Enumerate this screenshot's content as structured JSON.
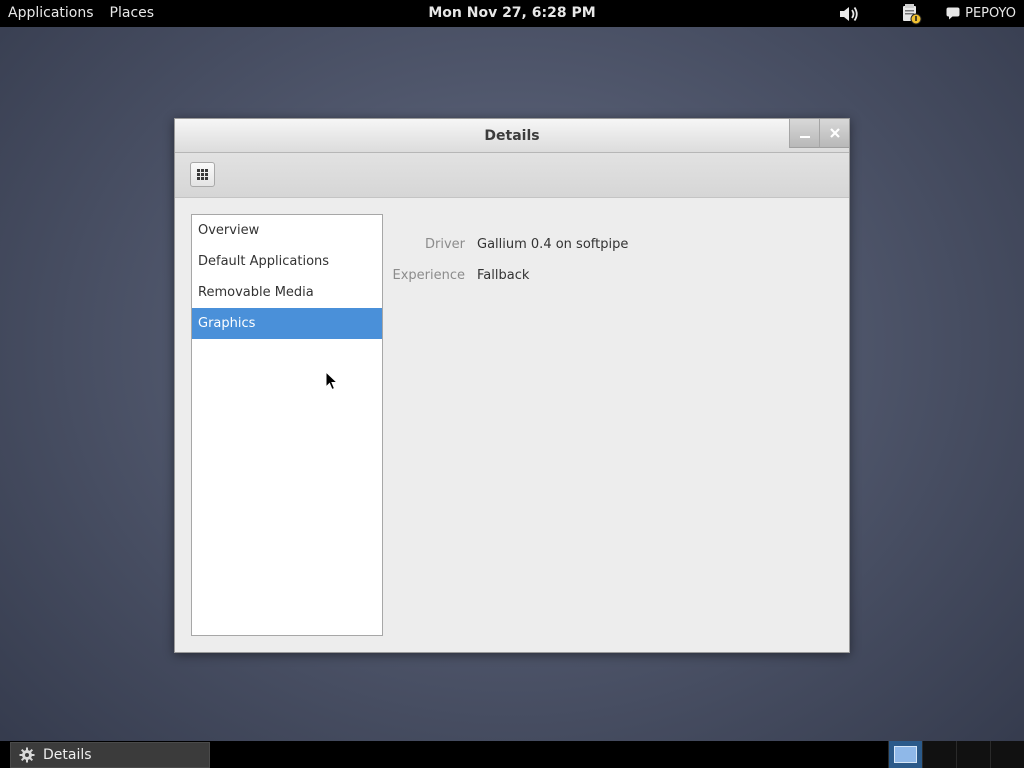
{
  "top_panel": {
    "applications": "Applications",
    "places": "Places",
    "clock": "Mon Nov 27,  6:28 PM",
    "user": "PEPOYO"
  },
  "window": {
    "title": "Details",
    "sidebar": {
      "items": [
        {
          "label": "Overview"
        },
        {
          "label": "Default Applications"
        },
        {
          "label": "Removable Media"
        },
        {
          "label": "Graphics",
          "selected": true
        }
      ]
    },
    "graphics": {
      "driver_label": "Driver",
      "driver_value": "Gallium 0.4 on softpipe",
      "experience_label": "Experience",
      "experience_value": "Fallback"
    }
  },
  "taskbar": {
    "task_label": "Details",
    "task_icon": "gear-icon",
    "workspaces": 4,
    "active_workspace": 1
  },
  "colors": {
    "selection": "#4a90d9",
    "panel": "#000000"
  }
}
